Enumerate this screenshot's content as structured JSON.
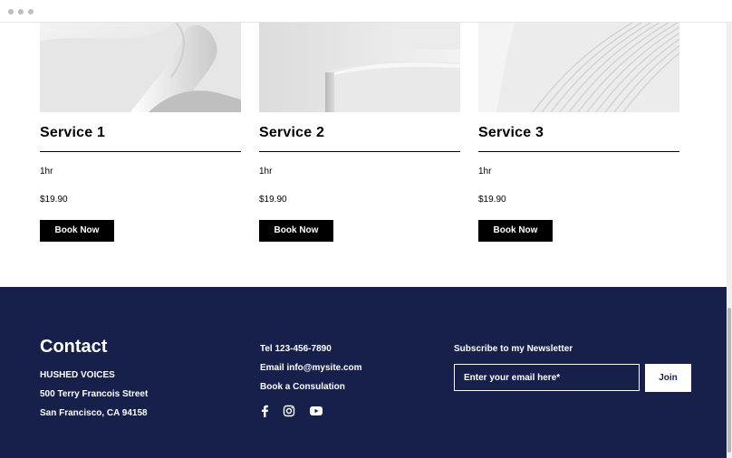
{
  "window": {
    "controls": [
      "window-dot",
      "window-dot",
      "window-dot"
    ]
  },
  "services": [
    {
      "title": "Service 1",
      "duration": "1hr",
      "price": "$19.90",
      "button_label": "Book Now"
    },
    {
      "title": "Service 2",
      "duration": "1hr",
      "price": "$19.90",
      "button_label": "Book Now"
    },
    {
      "title": "Service 3",
      "duration": "1hr",
      "price": "$19.90",
      "button_label": "Book Now"
    }
  ],
  "footer": {
    "contact_heading": "Contact",
    "company_name": "HUSHED VOICES",
    "address_line1": "500 Terry Francois Street",
    "address_line2": "San Francisco, CA 94158",
    "phone": "Tel 123-456-7890",
    "email": "Email info@mysite.com",
    "consultation_link": "Book a Consulation",
    "social_icons": [
      "facebook-icon",
      "instagram-icon",
      "youtube-icon"
    ],
    "newsletter": {
      "label": "Subscribe to my Newsletter",
      "placeholder": "Enter your email here*",
      "value": "",
      "button_label": "Join"
    }
  },
  "colors": {
    "footer_bg": "#17204a",
    "button_bg": "#000000",
    "text_on_dark": "#ffffff"
  }
}
